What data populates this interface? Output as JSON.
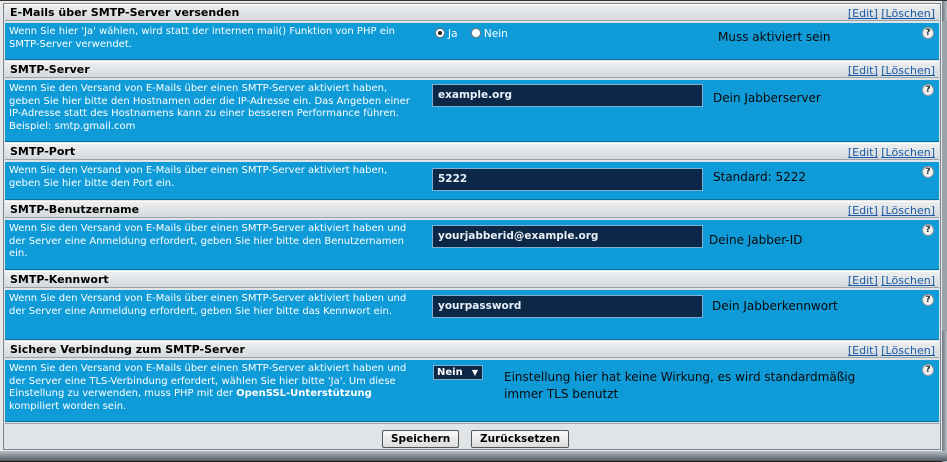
{
  "sections": [
    {
      "title": "E-Mails über SMTP-Server versenden",
      "edit": "[Edit]",
      "delete": "[Löschen]",
      "desc": "Wenn Sie hier 'Ja' wählen, wird statt der internen mail() Funktion von PHP ein SMTP-Server verwendet.",
      "radio_yes": "Ja",
      "radio_no": "Nein",
      "note": "Muss aktiviert sein"
    },
    {
      "title": "SMTP-Server",
      "edit": "[Edit]",
      "delete": "[Löschen]",
      "desc": "Wenn Sie den Versand von E-Mails über einen SMTP-Server aktiviert haben, geben Sie hier bitte den Hostnamen oder die IP-Adresse ein. Das Angeben einer IP-Adresse statt des Hostnamens kann zu einer besseren Performance führen. Beispiel: smtp.gmail.com",
      "value": "example.org",
      "note": "Dein Jabberserver"
    },
    {
      "title": "SMTP-Port",
      "edit": "[Edit]",
      "delete": "[Löschen]",
      "desc": "Wenn Sie den Versand von E-Mails über einen SMTP-Server aktiviert haben, geben Sie hier bitte den Port ein.",
      "value": "5222",
      "note": "Standard: 5222"
    },
    {
      "title": "SMTP-Benutzername",
      "edit": "[Edit]",
      "delete": "[Löschen]",
      "desc": "Wenn Sie den Versand von E-Mails über einen SMTP-Server aktiviert haben und der Server eine Anmeldung erfordert, geben Sie hier bitte den Benutzernamen ein.",
      "value": "yourjabberid@example.org",
      "note": "Deine Jabber-ID"
    },
    {
      "title": "SMTP-Kennwort",
      "edit": "[Edit]",
      "delete": "[Löschen]",
      "desc": "Wenn Sie den Versand von E-Mails über einen SMTP-Server aktiviert haben und der Server eine Anmeldung erfordert, geben Sie hier bitte das Kennwort ein.",
      "value": "yourpassword",
      "note": "Dein Jabberkennwort"
    },
    {
      "title": "Sichere Verbindung zum SMTP-Server",
      "edit": "[Edit]",
      "delete": "[Löschen]",
      "desc_part1": "Wenn Sie den Versand von E-Mails über einen SMTP-Server aktiviert haben und der Server eine TLS-Verbindung erfordert, wählen Sie hier bitte 'Ja'. Um diese Einstellung zu verwenden, muss PHP mit der ",
      "desc_bold": "OpenSSL-Unterstützung",
      "desc_part2": " kompiliert worden sein.",
      "select_value": "Nein",
      "note": "Einstellung hier hat keine Wirkung, es wird standardmäßig immer TLS benutzt"
    }
  ],
  "help_symbol": "?",
  "buttons": {
    "save": "Speichern",
    "reset": "Zurücksetzen"
  }
}
